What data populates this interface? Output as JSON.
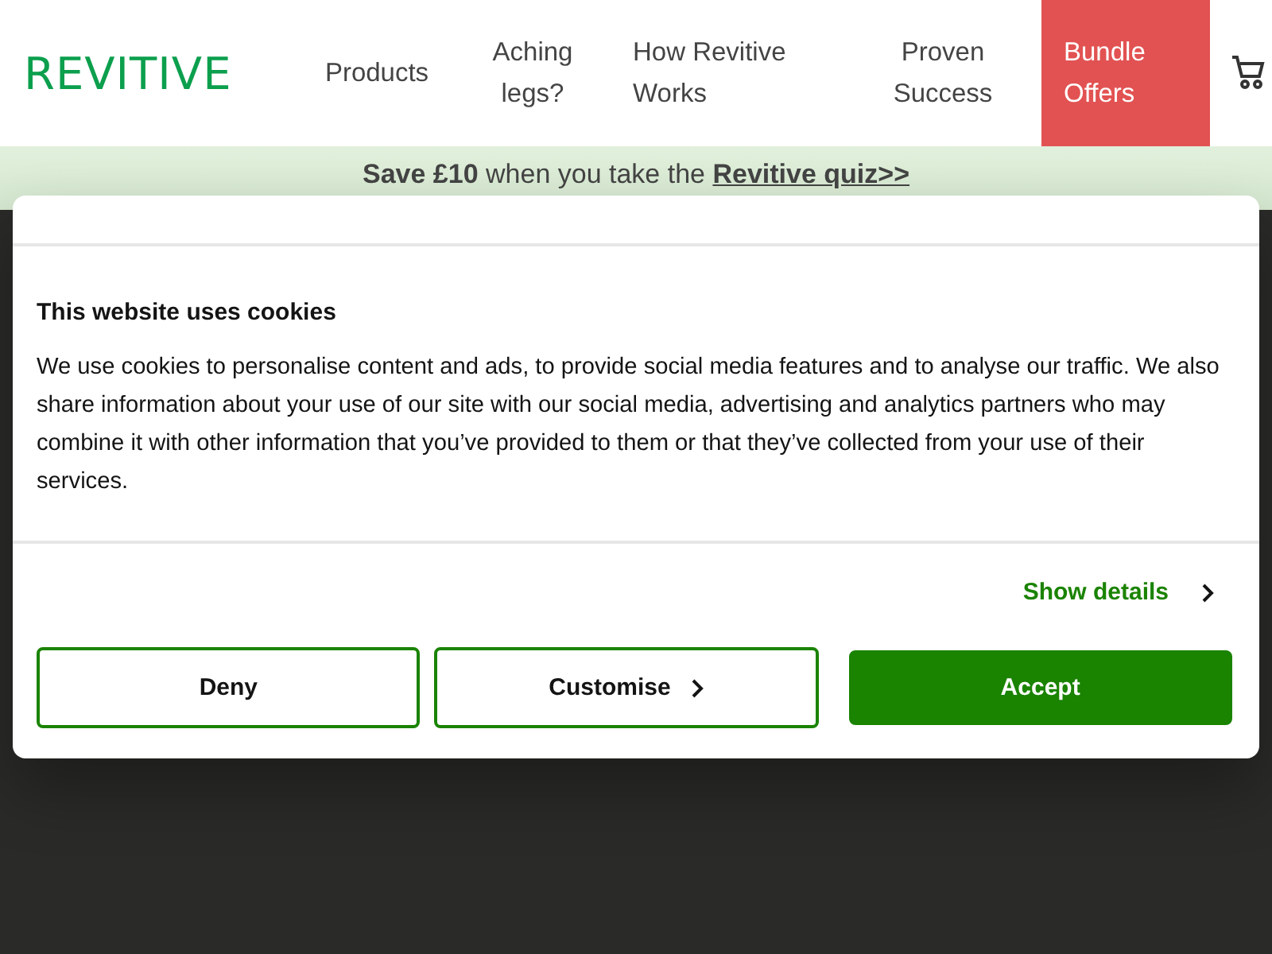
{
  "header": {
    "logo": "REVITIVE",
    "nav": [
      {
        "label": "Products",
        "kind": "link"
      },
      {
        "label": "Aching legs?",
        "kind": "link"
      },
      {
        "label": "How Revitive Works",
        "kind": "link"
      },
      {
        "label": "Proven Success",
        "kind": "link"
      },
      {
        "label": "Bundle Offers",
        "kind": "offer"
      }
    ]
  },
  "banner": {
    "text": "**Save £10** when you take the ",
    "link": "Revitive quiz>>"
  },
  "cookie_dialog": {
    "title": "This website uses cookies",
    "body": "We use cookies to personalise content and ads, to provide social media features and to analyse our traffic. We also share information about your use of our site with our social media, advertising and analytics partners who may combine it with other information that you’ve provided to them or that they’ve collected from your use of their services.",
    "details_link": "Show details",
    "buttons": [
      {
        "label": "Deny",
        "kind": "outline",
        "chevron": false
      },
      {
        "label": "Customise",
        "kind": "outline",
        "chevron": true
      },
      {
        "label": "Accept",
        "kind": "filled",
        "chevron": false
      }
    ]
  }
}
